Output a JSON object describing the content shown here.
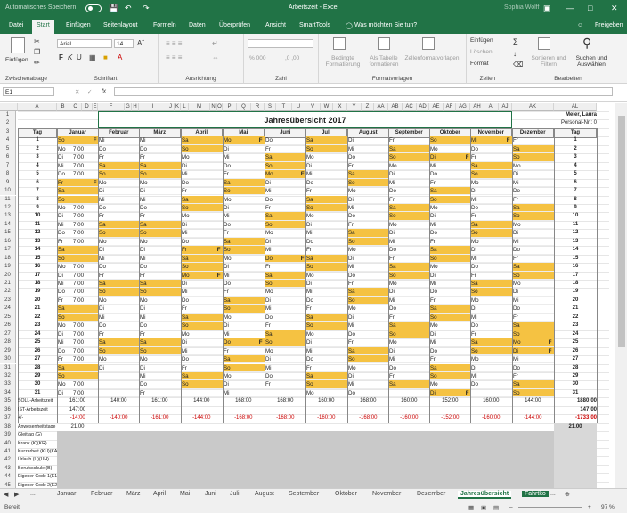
{
  "title_bar": {
    "autosave": "Automatisches Speichern",
    "autosave_state": "Aus",
    "title": "Arbeitszeit - Excel",
    "user": "Sophia Wolff"
  },
  "ribbon_tabs": [
    "Datei",
    "Start",
    "Einfügen",
    "Seitenlayout",
    "Formeln",
    "Daten",
    "Überprüfen",
    "Ansicht",
    "SmartTools",
    "Was möchten Sie tun?",
    "Freigeben"
  ],
  "ribbon": {
    "paste": "Einfügen",
    "clipboard": "Zwischenablage",
    "font_name": "Arial",
    "font_size": "14",
    "font_group": "Schriftart",
    "alignment": "Ausrichtung",
    "number": "Zahl",
    "cond_format": "Bedingte Formatierung",
    "as_table": "Als Tabelle formatieren",
    "cell_styles": "Zellenformatvorlagen",
    "styles": "Formatvorlagen",
    "insert": "Einfügen",
    "delete": "Löschen",
    "format": "Format",
    "cells": "Zellen",
    "sort_filter": "Sortieren und Filtern",
    "find_select": "Suchen und Auswählen",
    "editing": "Bearbeiten"
  },
  "formula_bar": {
    "name_box": "E1",
    "fx": "fx",
    "value": ""
  },
  "sheet": {
    "columns": [
      "A",
      "B",
      "C",
      "D",
      "E",
      "F",
      "G",
      "H",
      "I",
      "J",
      "K",
      "L",
      "M",
      "N",
      "O",
      "P",
      "Q",
      "R",
      "S",
      "T",
      "U",
      "V",
      "W",
      "X",
      "Y",
      "Z",
      "AA",
      "AB",
      "AC",
      "AD",
      "AE",
      "AF",
      "AG",
      "AH",
      "AI",
      "AJ",
      "AK",
      "AL"
    ],
    "title": "Jahresübersicht 2017",
    "person": "Meier, Laura",
    "personal_nr": "Personal-Nr.: 0",
    "tag_label": "Tag",
    "months": [
      "Januar",
      "Februar",
      "März",
      "April",
      "Mai",
      "Juni",
      "Juli",
      "August",
      "September",
      "Oktober",
      "November",
      "Dezember"
    ],
    "days": [
      "1",
      "2",
      "3",
      "4",
      "5",
      "6",
      "7",
      "8",
      "9",
      "10",
      "11",
      "12",
      "13",
      "14",
      "15",
      "16",
      "17",
      "18",
      "19",
      "20",
      "21",
      "22",
      "23",
      "24",
      "25",
      "26",
      "27",
      "28",
      "29",
      "30",
      "31"
    ],
    "weekday_names": [
      "Mo",
      "Di",
      "Mi",
      "Do",
      "Fr",
      "Sa",
      "So"
    ],
    "month_start_weekday": [
      6,
      2,
      2,
      5,
      0,
      3,
      5,
      1,
      4,
      6,
      2,
      4
    ],
    "month_length": [
      31,
      28,
      31,
      30,
      31,
      30,
      31,
      31,
      30,
      31,
      30,
      31
    ],
    "holidays": [
      [
        1,
        "F"
      ],
      [
        6,
        "F"
      ],
      [
        null
      ],
      [],
      [],
      [],
      [],
      [],
      [],
      [],
      [],
      []
    ],
    "hours_value": "7:00",
    "summary_labels": [
      "SOLL-Arbeitszeit",
      "IST-Arbeitszeit",
      "+/-",
      "Anwesenheitstage",
      "Gleittag (G)",
      "Krank (K)(KR)",
      "Kurzarbeit (KU)(KA)",
      "Urlaub (U)(UH)",
      "Berufsschule (B)",
      "Eigener Code 1(E1)",
      "Eigener Code 2(E2)",
      "Eigener Code 3(E3)",
      "Eigener C + ,+,+ +(E)",
      "Eigener Code 5(E5)"
    ],
    "soll": [
      "",
      "140:00",
      "161:00",
      "144:00",
      "168:00",
      "168:00",
      "160:00",
      "168:00",
      "160:00",
      "152:00",
      "160:00",
      "144:00"
    ],
    "soll_jan": "161:00",
    "ist_jan": "147:00",
    "diff": [
      "-14:00",
      "-140:00",
      "-161:00",
      "-144:00",
      "-168:00",
      "-168:00",
      "-160:00",
      "-168:00",
      "-160:00",
      "-152:00",
      "-160:00",
      "-144:00"
    ],
    "anwesenheit_jan": "21,00",
    "total_soll": "1880:00",
    "total_ist": "147:00",
    "total_diff": "-1733:00",
    "total_anw": "21,00",
    "rows_numbers": [
      "1",
      "2",
      "3",
      "4",
      "5",
      "6",
      "7",
      "8",
      "9",
      "10",
      "11",
      "12",
      "13",
      "14",
      "15",
      "16",
      "17",
      "18",
      "19",
      "20",
      "21",
      "22",
      "23",
      "24",
      "25",
      "26",
      "27",
      "28",
      "29",
      "30",
      "31",
      "32",
      "33",
      "34",
      "35",
      "36",
      "37",
      "38",
      "39",
      "40",
      "41",
      "42",
      "43",
      "44",
      "45",
      "46",
      "47",
      "48"
    ]
  },
  "sheet_tabs": [
    "Januar",
    "Februar",
    "März",
    "April",
    "Mai",
    "Juni",
    "Juli",
    "August",
    "September",
    "Oktober",
    "November",
    "Dezember",
    "Jahresübersicht",
    "Fahrtko"
  ],
  "status": {
    "ready": "Bereit",
    "zoom": "97 %"
  },
  "colors": {
    "excel_green": "#217346",
    "weekend": "#f5c242"
  }
}
